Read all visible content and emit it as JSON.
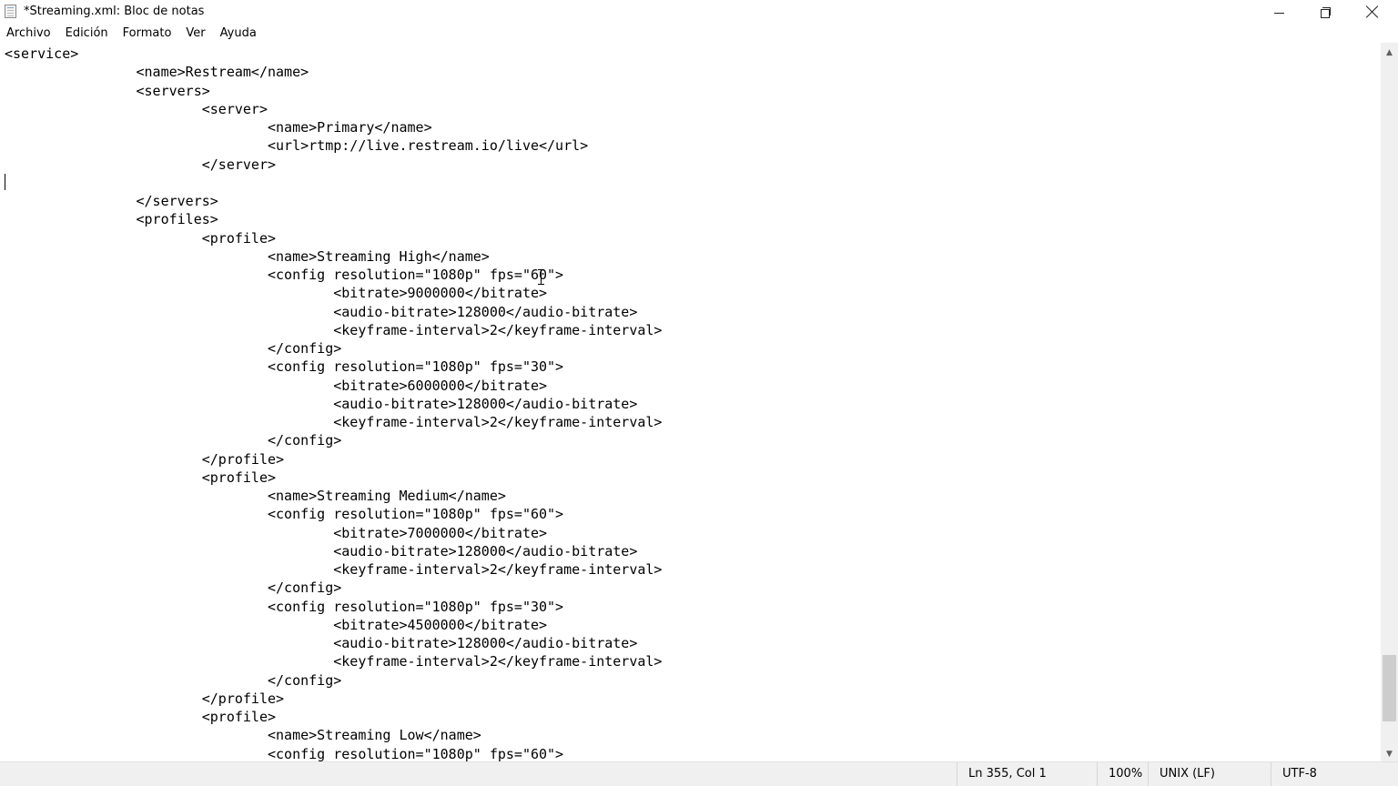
{
  "window": {
    "title": "*Streaming.xml: Bloc de notas",
    "icon": "notepad-icon",
    "controls": {
      "minimize": "minimize-icon",
      "maximize": "restore-icon",
      "close": "close-icon"
    }
  },
  "menu": {
    "items": [
      "Archivo",
      "Edición",
      "Formato",
      "Ver",
      "Ayuda"
    ]
  },
  "editor": {
    "lines": [
      "<service>",
      "\t\t<name>Restream</name>",
      "\t\t<servers>",
      "\t\t\t<server>",
      "\t\t\t\t<name>Primary</name>",
      "\t\t\t\t<url>rtmp://live.restream.io/live</url>",
      "\t\t\t</server>",
      "",
      "\t\t</servers>",
      "\t\t<profiles>",
      "\t\t\t<profile>",
      "\t\t\t\t<name>Streaming High</name>",
      "\t\t\t\t<config resolution=\"1080p\" fps=\"60\">",
      "\t\t\t\t\t<bitrate>9000000</bitrate>",
      "\t\t\t\t\t<audio-bitrate>128000</audio-bitrate>",
      "\t\t\t\t\t<keyframe-interval>2</keyframe-interval>",
      "\t\t\t\t</config>",
      "\t\t\t\t<config resolution=\"1080p\" fps=\"30\">",
      "\t\t\t\t\t<bitrate>6000000</bitrate>",
      "\t\t\t\t\t<audio-bitrate>128000</audio-bitrate>",
      "\t\t\t\t\t<keyframe-interval>2</keyframe-interval>",
      "\t\t\t\t</config>",
      "\t\t\t</profile>",
      "\t\t\t<profile>",
      "\t\t\t\t<name>Streaming Medium</name>",
      "\t\t\t\t<config resolution=\"1080p\" fps=\"60\">",
      "\t\t\t\t\t<bitrate>7000000</bitrate>",
      "\t\t\t\t\t<audio-bitrate>128000</audio-bitrate>",
      "\t\t\t\t\t<keyframe-interval>2</keyframe-interval>",
      "\t\t\t\t</config>",
      "\t\t\t\t<config resolution=\"1080p\" fps=\"30\">",
      "\t\t\t\t\t<bitrate>4500000</bitrate>",
      "\t\t\t\t\t<audio-bitrate>128000</audio-bitrate>",
      "\t\t\t\t\t<keyframe-interval>2</keyframe-interval>",
      "\t\t\t\t</config>",
      "\t\t\t</profile>",
      "\t\t\t<profile>",
      "\t\t\t\t<name>Streaming Low</name>",
      "\t\t\t\t<config resolution=\"1080p\" fps=\"60\">"
    ]
  },
  "statusbar": {
    "position": "Ln 355, Col 1",
    "zoom": "100%",
    "line_ending": "UNIX (LF)",
    "encoding": "UTF-8"
  }
}
